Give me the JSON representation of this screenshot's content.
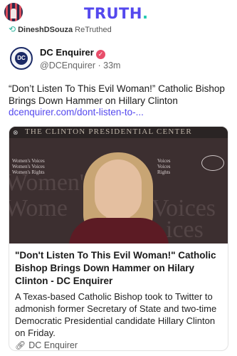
{
  "header": {
    "logo_text": "TRUTH",
    "logo_dot": ".",
    "logo_color": "#5448ee",
    "accent_color": "#21c8b1"
  },
  "retruth": {
    "user": "DineshDSouza",
    "action": "ReTruthed"
  },
  "post": {
    "account_name": "DC Enquirer",
    "account_handle": "@DCEnquirer",
    "separator": "·",
    "time": "33m",
    "avatar_text": "DC",
    "text": "“Don’t Listen To This Evil Woman!” Catholic Bishop Brings Down Hammer on Hillary Clinton",
    "link": "dcenquirer.com/dont-listen-to-..."
  },
  "card": {
    "image_banner": "THE CLINTON PRESIDENTIAL CENTER",
    "image_sign_left": [
      "Women's Voices",
      "Women's Voices",
      "Women's Rights"
    ],
    "image_sign_right": [
      "Voices",
      "Voices",
      "Rights"
    ],
    "title": "\"Don't Listen To This Evil Woman!\" Catholic Bishop Brings Down Hammer on Hilary Clinton - DC Enquirer",
    "description": "A Texas-based Catholic Bishop took to Twitter to admonish former Secretary of State and two-time Democratic Presidential candidate Hillary Clinton on Friday.",
    "source": "DC Enquirer"
  }
}
